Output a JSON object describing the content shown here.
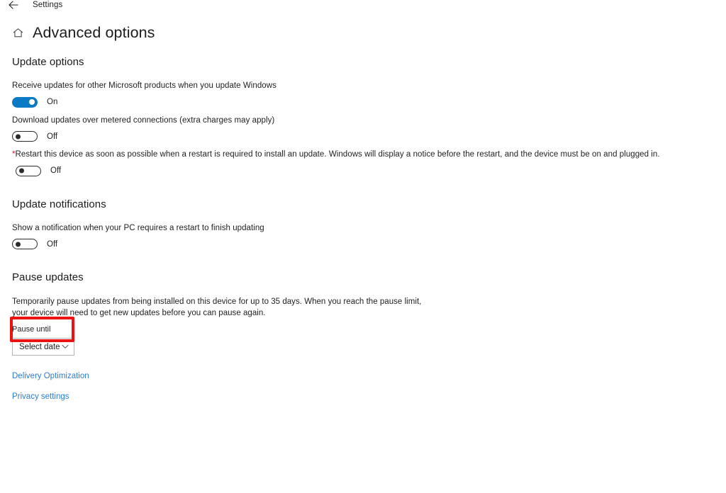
{
  "titlebar": {
    "back_icon": "back-arrow-icon",
    "app_title": "Settings"
  },
  "header": {
    "home_icon": "home-icon",
    "page_title": "Advanced options"
  },
  "sections": {
    "update_options": {
      "title": "Update options",
      "settings": [
        {
          "description": "Receive updates for other Microsoft products when you update Windows",
          "state": "On"
        },
        {
          "description": "Download updates over metered connections (extra charges may apply)",
          "state": "Off"
        },
        {
          "asterisk": "*",
          "description": "Restart this device as soon as possible when a restart is required to install an update. Windows will display a notice before the restart, and the device must be on and plugged in.",
          "state": "Off"
        }
      ]
    },
    "update_notifications": {
      "title": "Update notifications",
      "settings": [
        {
          "description": "Show a notification when your PC requires a restart to finish updating",
          "state": "Off"
        }
      ]
    },
    "pause_updates": {
      "title": "Pause updates",
      "paragraph": "Temporarily pause updates from being installed on this device for up to 35 days. When you reach the pause limit, your device will need to get new updates before you can pause again.",
      "field_label": "Pause until",
      "dropdown_value": "Select date",
      "dropdown_icon": "chevron-down-icon"
    }
  },
  "links": [
    {
      "label": "Delivery Optimization"
    },
    {
      "label": "Privacy settings"
    }
  ],
  "annotation": {
    "color": "#ee1111",
    "target": "pause-until-dropdown"
  }
}
